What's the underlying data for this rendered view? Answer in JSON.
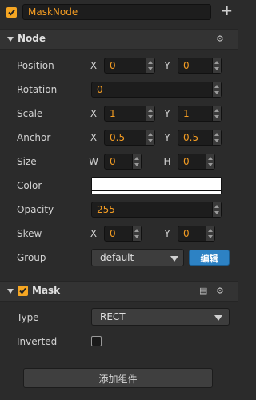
{
  "node": {
    "name": "MaskNode",
    "add_glyph": "+"
  },
  "node_section": {
    "title": "Node",
    "position": {
      "label": "Position",
      "x_axis": "X",
      "x": "0",
      "y_axis": "Y",
      "y": "0"
    },
    "rotation": {
      "label": "Rotation",
      "value": "0"
    },
    "scale": {
      "label": "Scale",
      "x_axis": "X",
      "x": "1",
      "y_axis": "Y",
      "y": "1"
    },
    "anchor": {
      "label": "Anchor",
      "x_axis": "X",
      "x": "0.5",
      "y_axis": "Y",
      "y": "0.5"
    },
    "size": {
      "label": "Size",
      "w_axis": "W",
      "w": "0",
      "h_axis": "H",
      "h": "0"
    },
    "color": {
      "label": "Color",
      "value": "#ffffff"
    },
    "opacity": {
      "label": "Opacity",
      "value": "255"
    },
    "skew": {
      "label": "Skew",
      "x_axis": "X",
      "x": "0",
      "y_axis": "Y",
      "y": "0"
    },
    "group": {
      "label": "Group",
      "selected": "default",
      "edit_label": "编辑"
    }
  },
  "mask_section": {
    "title": "Mask",
    "type": {
      "label": "Type",
      "selected": "RECT"
    },
    "inverted": {
      "label": "Inverted",
      "checked": false
    }
  },
  "footer": {
    "add_component_label": "添加组件"
  },
  "colors": {
    "accent": "#f5a623",
    "value_text": "#f39c23",
    "edit_button": "#2d82c4",
    "background": "#2b2b2b"
  }
}
